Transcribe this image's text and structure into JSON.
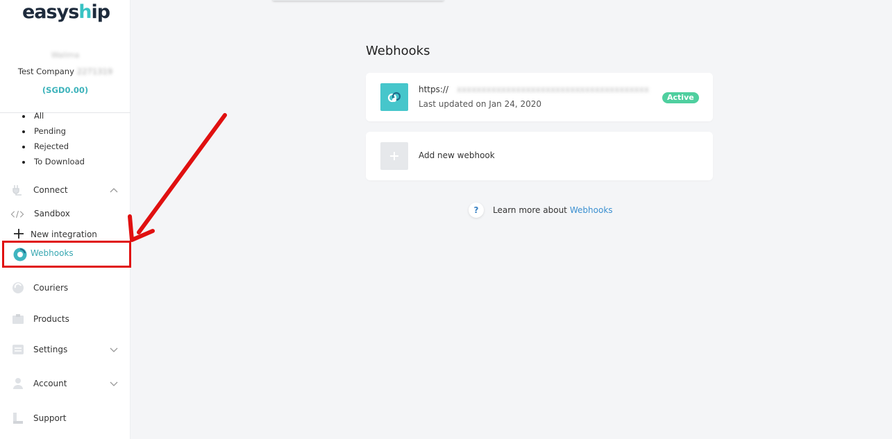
{
  "brand": {
    "logo_prefix": "easys",
    "logo_dot": "h",
    "logo_suffix": "ip"
  },
  "user": {
    "name": "Walima",
    "company": "Test Company",
    "company_id": "2271319",
    "balance": "(SGD0.00)"
  },
  "shipments_sub": [
    "All",
    "Pending",
    "Rejected",
    "To Download"
  ],
  "nav": {
    "connect": "Connect",
    "sandbox": "Sandbox",
    "new_integration": "New integration",
    "webhooks": "Webhooks",
    "couriers": "Couriers",
    "products": "Products",
    "settings": "Settings",
    "account": "Account",
    "support": "Support"
  },
  "main": {
    "title": "Webhooks",
    "webhook": {
      "url": "https://",
      "url_hidden": "xxxxxxxxxxxxxxxxxxxxxxxxxxxxxxxxxxxxxxx",
      "updated": "Last updated on Jan 24, 2020",
      "status": "Active"
    },
    "add_label": "Add new webhook",
    "learn_text": "Learn more about",
    "learn_link": "Webhooks",
    "help_glyph": "?"
  },
  "colors": {
    "accent": "#39c3c4",
    "active_badge": "#4fcf9f",
    "link": "#3a8fd0",
    "annotation": "#e01010"
  }
}
